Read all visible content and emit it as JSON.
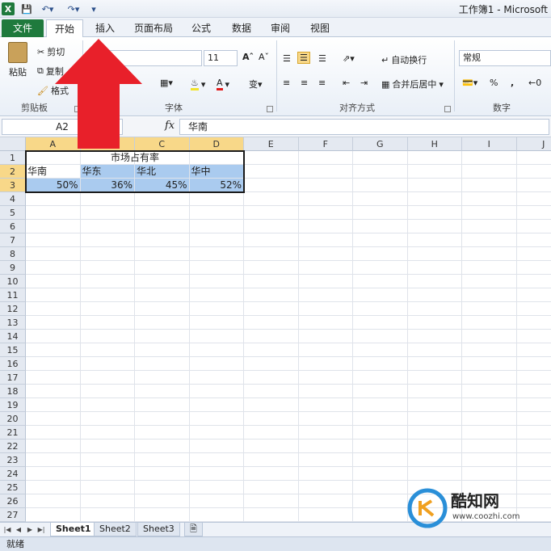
{
  "app": {
    "title": "工作簿1 - Microsoft"
  },
  "tabs": [
    {
      "label": "文件"
    },
    {
      "label": "开始"
    },
    {
      "label": "插入"
    },
    {
      "label": "页面布局"
    },
    {
      "label": "公式"
    },
    {
      "label": "数据"
    },
    {
      "label": "审阅"
    },
    {
      "label": "视图"
    }
  ],
  "ribbon": {
    "clipboard": {
      "paste": "粘贴",
      "cut": "剪切",
      "copy": "复制",
      "format": "格式",
      "label": "剪贴板"
    },
    "font": {
      "size": "11",
      "label": "字体"
    },
    "align": {
      "wrap": "自动换行",
      "merge": "合并后居中",
      "label": "对齐方式"
    },
    "number": {
      "format": "常规",
      "percent": "%",
      "comma": ",",
      "label": "数字"
    }
  },
  "formula_bar": {
    "name_box": "A2",
    "fx": "fx",
    "content": "华南"
  },
  "grid": {
    "columns": [
      "A",
      "B",
      "C",
      "D",
      "E",
      "F",
      "G",
      "H",
      "I",
      "J"
    ],
    "rows": [
      "1",
      "2",
      "3",
      "4",
      "5",
      "6",
      "7",
      "8",
      "9",
      "10",
      "11",
      "12",
      "13",
      "14",
      "15",
      "16",
      "17",
      "18",
      "19",
      "20",
      "21",
      "22",
      "23",
      "24",
      "25",
      "26",
      "27"
    ],
    "title": "市场占有率",
    "regions": [
      "华南",
      "华东",
      "华北",
      "华中"
    ],
    "shares": [
      "50%",
      "36%",
      "45%",
      "52%"
    ]
  },
  "sheets": [
    {
      "label": "Sheet1"
    },
    {
      "label": "Sheet2"
    },
    {
      "label": "Sheet3"
    }
  ],
  "status": {
    "text": "就绪"
  },
  "watermark": {
    "brand": "酷知网",
    "url": "www.coozhi.com"
  },
  "colors": {
    "file_tab": "#1f7a3d",
    "selection": "#aacbef",
    "arrow": "#e8202a",
    "header_sel": "#f8d889"
  }
}
